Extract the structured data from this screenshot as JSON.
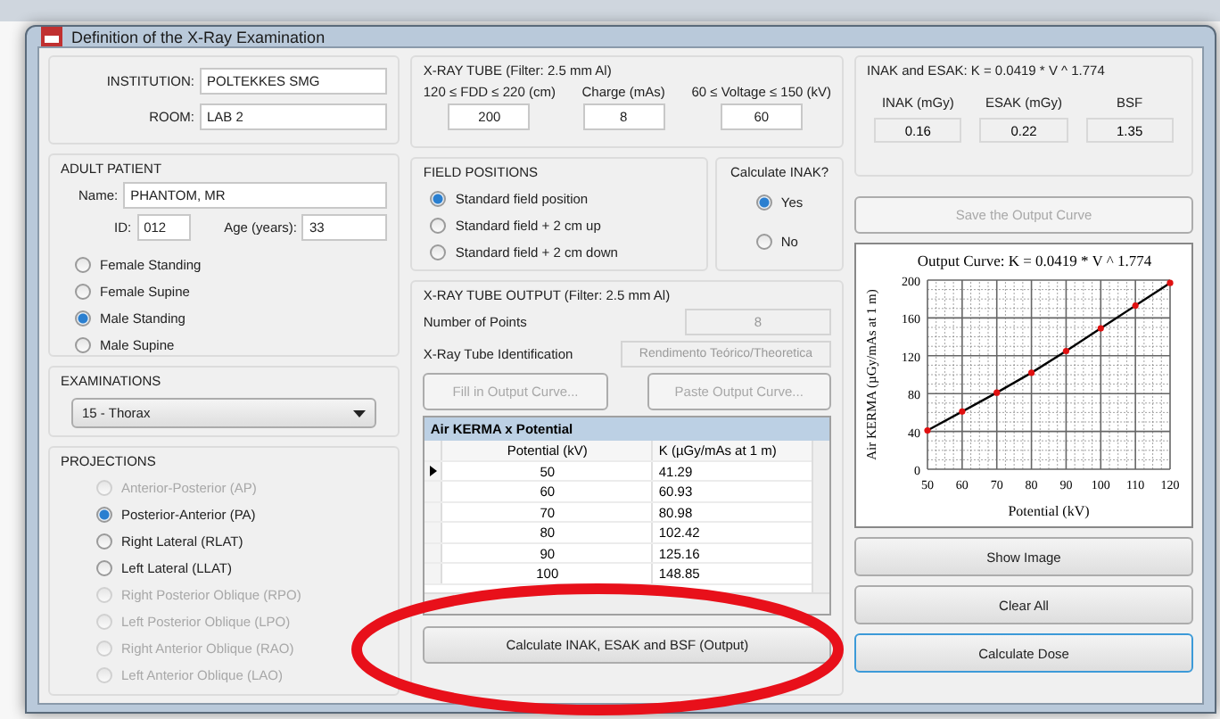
{
  "window": {
    "title": "Definition of the X-Ray Examination"
  },
  "institution": {
    "institution_label": "INSTITUTION:",
    "institution_value": "POLTEKKES SMG",
    "room_label": "ROOM:",
    "room_value": "LAB 2"
  },
  "adult_patient": {
    "title": "ADULT PATIENT",
    "name_label": "Name:",
    "name_value": "PHANTOM, MR",
    "id_label": "ID:",
    "id_value": "012",
    "age_label": "Age (years):",
    "age_value": "33",
    "options": [
      {
        "label": "Female Standing",
        "selected": false
      },
      {
        "label": "Female Supine",
        "selected": false
      },
      {
        "label": "Male Standing",
        "selected": true
      },
      {
        "label": "Male Supine",
        "selected": false
      }
    ]
  },
  "examinations": {
    "title": "EXAMINATIONS",
    "value": "15 - Thorax"
  },
  "projections": {
    "title": "PROJECTIONS",
    "options": [
      {
        "label": "Anterior-Posterior (AP)",
        "selected": false,
        "disabled": true
      },
      {
        "label": "Posterior-Anterior (PA)",
        "selected": true,
        "disabled": false
      },
      {
        "label": "Right Lateral (RLAT)",
        "selected": false,
        "disabled": false
      },
      {
        "label": "Left Lateral (LLAT)",
        "selected": false,
        "disabled": false
      },
      {
        "label": "Right Posterior Oblique (RPO)",
        "selected": false,
        "disabled": true
      },
      {
        "label": "Left Posterior Oblique (LPO)",
        "selected": false,
        "disabled": true
      },
      {
        "label": "Right Anterior Oblique (RAO)",
        "selected": false,
        "disabled": true
      },
      {
        "label": "Left Anterior Oblique (LAO)",
        "selected": false,
        "disabled": true
      }
    ]
  },
  "xray_tube": {
    "title": "X-RAY TUBE (Filter: 2.5 mm Al)",
    "fields": [
      {
        "label": "120 ≤ FDD ≤ 220 (cm)",
        "value": "200"
      },
      {
        "label": "Charge (mAs)",
        "value": "8"
      },
      {
        "label": "60 ≤ Voltage ≤ 150 (kV)",
        "value": "60"
      }
    ]
  },
  "field_positions": {
    "title": "FIELD POSITIONS",
    "options": [
      {
        "label": "Standard field position",
        "selected": true
      },
      {
        "label": "Standard field + 2 cm up",
        "selected": false
      },
      {
        "label": "Standard field + 2 cm down",
        "selected": false
      }
    ]
  },
  "calculate_inak": {
    "title": "Calculate INAK?",
    "options": [
      {
        "label": "Yes",
        "selected": true
      },
      {
        "label": "No",
        "selected": false
      }
    ]
  },
  "tube_output": {
    "title": "X-RAY TUBE OUTPUT (Filter: 2.5 mm Al)",
    "points_label": "Number of Points",
    "points_value": "8",
    "id_label": "X-Ray Tube Identification",
    "id_value": "Rendimento Teórico/Theoretica",
    "fill_button": "Fill in Output Curve...",
    "paste_button": "Paste Output Curve...",
    "table": {
      "title": "Air KERMA x Potential",
      "columns": [
        "Potential (kV)",
        "K (µGy/mAs at 1 m)"
      ],
      "rows": [
        {
          "cells": [
            "50",
            "41.29"
          ],
          "selected": true
        },
        {
          "cells": [
            "60",
            "60.93"
          ],
          "selected": false
        },
        {
          "cells": [
            "70",
            "80.98"
          ],
          "selected": false
        },
        {
          "cells": [
            "80",
            "102.42"
          ],
          "selected": false
        },
        {
          "cells": [
            "90",
            "125.16"
          ],
          "selected": false
        },
        {
          "cells": [
            "100",
            "148.85"
          ],
          "selected": false
        }
      ]
    },
    "calculate_button": "Calculate INAK, ESAK and BSF (Output)"
  },
  "results": {
    "title": "INAK and ESAK: K = 0.0419 * V ^ 1.774",
    "items": [
      {
        "label": "INAK (mGy)",
        "value": "0.16"
      },
      {
        "label": "ESAK (mGy)",
        "value": "0.22"
      },
      {
        "label": "BSF",
        "value": "1.35"
      }
    ]
  },
  "save_button": "Save the Output Curve",
  "chart_data": {
    "type": "line",
    "title": "Output Curve: K = 0.0419 * V ^ 1.774",
    "xlabel": "Potential (kV)",
    "ylabel": "Air KERMA (µGy/mAs at 1 m)",
    "x": [
      50,
      60,
      70,
      80,
      90,
      100,
      110,
      120
    ],
    "series": [
      {
        "color": "#000000",
        "marker": "circle",
        "values": [
          41,
          61,
          81,
          102,
          125,
          149,
          173,
          197
        ]
      }
    ],
    "grid": true,
    "xlim": [
      50,
      120
    ],
    "ylim": [
      0,
      200
    ],
    "xticks": [
      50,
      60,
      70,
      80,
      90,
      100,
      110,
      120
    ],
    "yticks": [
      0,
      40,
      80,
      120,
      160,
      200
    ]
  },
  "buttons": [
    "Show Image",
    "Clear All",
    "Calculate Dose"
  ]
}
